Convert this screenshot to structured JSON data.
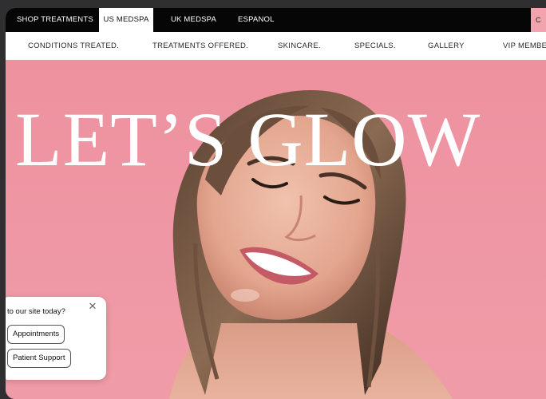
{
  "topbar": {
    "tabs": [
      {
        "label": "SHOP TREATMENTS",
        "active": false
      },
      {
        "label": "US MEDSPA",
        "active": true
      },
      {
        "label": "UK MEDSPA",
        "active": false
      },
      {
        "label": "ESPANOL",
        "active": false
      }
    ],
    "edge_button": "C"
  },
  "nav": {
    "items": [
      {
        "label": "CONDITIONS TREATED."
      },
      {
        "label": "TREATMENTS OFFERED."
      },
      {
        "label": "SKINCARE."
      },
      {
        "label": "SPECIALS."
      },
      {
        "label": "GALLERY"
      },
      {
        "label": "VIP MEMBE"
      }
    ]
  },
  "hero": {
    "headline": "LET’S GLOW",
    "background_color": "#ef97a4"
  },
  "chat": {
    "question": "to our site today?",
    "options": [
      "Appointments",
      "Patient Support"
    ],
    "close_icon": "close-icon"
  }
}
